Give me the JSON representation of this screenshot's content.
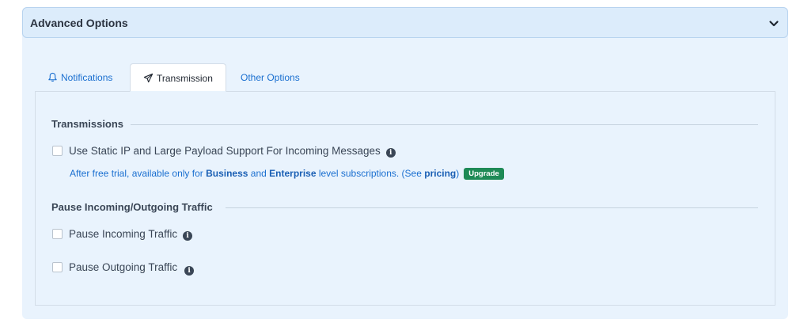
{
  "panel": {
    "title": "Advanced Options",
    "chevron_icon": "chevron-down-icon"
  },
  "tabs": [
    {
      "label": "Notifications",
      "icon": "bell-icon",
      "active": false
    },
    {
      "label": "Transmission",
      "icon": "paper-plane-icon",
      "active": true
    },
    {
      "label": "Other Options",
      "icon": "",
      "active": false
    }
  ],
  "transmissions": {
    "heading": "Transmissions",
    "static_ip_label": "Use Static IP and Large Payload Support For Incoming Messages",
    "static_ip_checked": false,
    "note_prefix": "After free trial, available only for ",
    "note_business": "Business",
    "note_and": " and ",
    "note_enterprise": "Enterprise",
    "note_middle": " level subscriptions. (See ",
    "note_link": "pricing",
    "note_suffix": ")",
    "upgrade_badge": "Upgrade",
    "badge_color": "#1e8a56"
  },
  "pause": {
    "heading": "Pause Incoming/Outgoing Traffic",
    "incoming_label": "Pause Incoming Traffic",
    "incoming_checked": false,
    "outgoing_label": "Pause Outgoing Traffic",
    "outgoing_checked": false
  },
  "colors": {
    "accent": "#1a6fd0",
    "panel_bg": "#e9f3fd",
    "header_bg": "#dcecfb"
  }
}
